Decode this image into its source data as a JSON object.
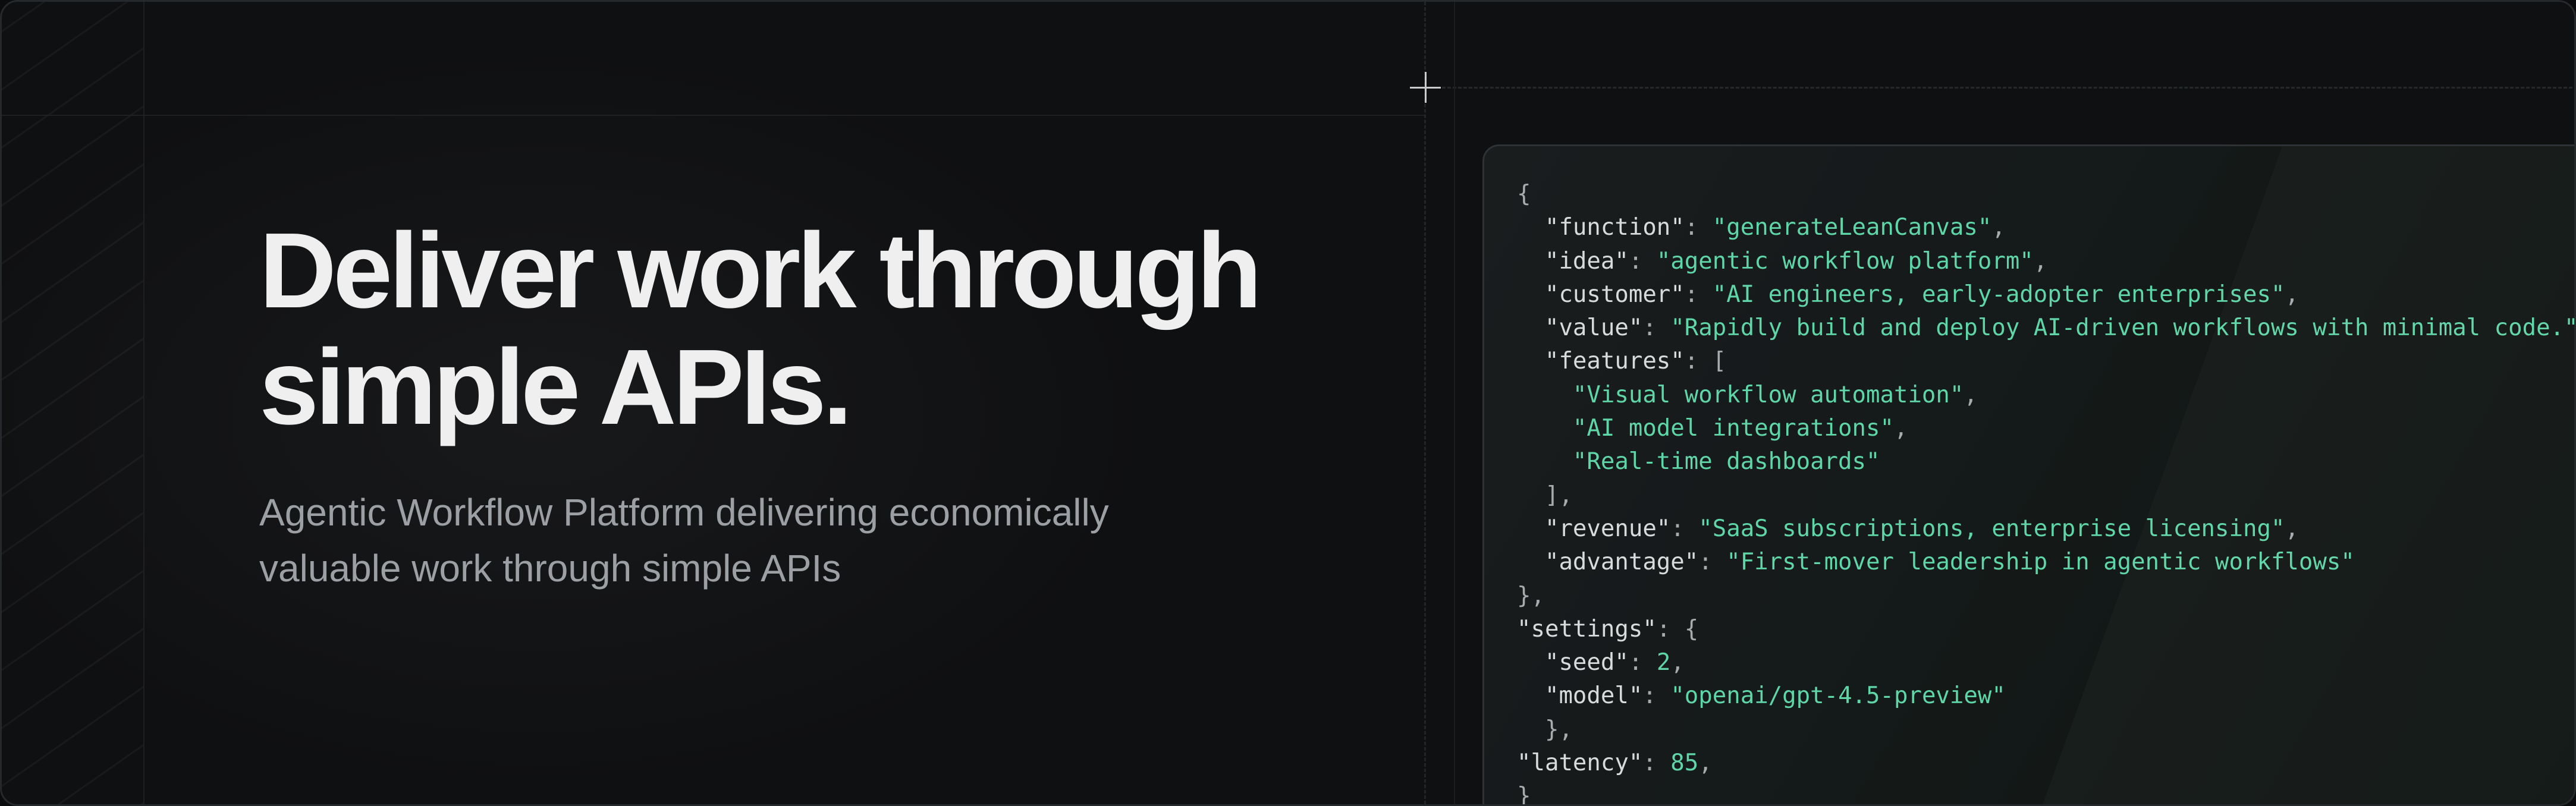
{
  "headline": {
    "line1": "Deliver work through",
    "line2": "simple APIs."
  },
  "subheadline": {
    "line1": "Agentic Workflow Platform delivering economically",
    "line2": "valuable work through simple APIs"
  },
  "code_sample": {
    "lines": [
      [
        {
          "t": "p",
          "v": "{"
        }
      ],
      [
        {
          "t": "p",
          "v": "  "
        },
        {
          "t": "k",
          "v": "\"function\""
        },
        {
          "t": "p",
          "v": ": "
        },
        {
          "t": "s",
          "v": "\"generateLeanCanvas\""
        },
        {
          "t": "p",
          "v": ","
        }
      ],
      [
        {
          "t": "p",
          "v": "  "
        },
        {
          "t": "k",
          "v": "\"idea\""
        },
        {
          "t": "p",
          "v": ": "
        },
        {
          "t": "s",
          "v": "\"agentic workflow platform\""
        },
        {
          "t": "p",
          "v": ","
        }
      ],
      [
        {
          "t": "p",
          "v": "  "
        },
        {
          "t": "k",
          "v": "\"customer\""
        },
        {
          "t": "p",
          "v": ": "
        },
        {
          "t": "s",
          "v": "\"AI engineers, early-adopter enterprises\""
        },
        {
          "t": "p",
          "v": ","
        }
      ],
      [
        {
          "t": "p",
          "v": "  "
        },
        {
          "t": "k",
          "v": "\"value\""
        },
        {
          "t": "p",
          "v": ": "
        },
        {
          "t": "s",
          "v": "\"Rapidly build and deploy AI-driven workflows with minimal code.\""
        }
      ],
      [
        {
          "t": "p",
          "v": "  "
        },
        {
          "t": "k",
          "v": "\"features\""
        },
        {
          "t": "p",
          "v": ": ["
        }
      ],
      [
        {
          "t": "p",
          "v": "    "
        },
        {
          "t": "s",
          "v": "\"Visual workflow automation\""
        },
        {
          "t": "p",
          "v": ","
        }
      ],
      [
        {
          "t": "p",
          "v": "    "
        },
        {
          "t": "s",
          "v": "\"AI model integrations\""
        },
        {
          "t": "p",
          "v": ","
        }
      ],
      [
        {
          "t": "p",
          "v": "    "
        },
        {
          "t": "s",
          "v": "\"Real-time dashboards\""
        }
      ],
      [
        {
          "t": "p",
          "v": "  ],"
        }
      ],
      [
        {
          "t": "p",
          "v": "  "
        },
        {
          "t": "k",
          "v": "\"revenue\""
        },
        {
          "t": "p",
          "v": ": "
        },
        {
          "t": "s",
          "v": "\"SaaS subscriptions, enterprise licensing\""
        },
        {
          "t": "p",
          "v": ","
        }
      ],
      [
        {
          "t": "p",
          "v": "  "
        },
        {
          "t": "k",
          "v": "\"advantage\""
        },
        {
          "t": "p",
          "v": ": "
        },
        {
          "t": "s",
          "v": "\"First-mover leadership in agentic workflows\""
        }
      ],
      [
        {
          "t": "p",
          "v": "},"
        }
      ],
      [
        {
          "t": "k",
          "v": "\"settings\""
        },
        {
          "t": "p",
          "v": ": {"
        }
      ],
      [
        {
          "t": "p",
          "v": "  "
        },
        {
          "t": "k",
          "v": "\"seed\""
        },
        {
          "t": "p",
          "v": ": "
        },
        {
          "t": "n",
          "v": "2"
        },
        {
          "t": "p",
          "v": ","
        }
      ],
      [
        {
          "t": "p",
          "v": "  "
        },
        {
          "t": "k",
          "v": "\"model\""
        },
        {
          "t": "p",
          "v": ": "
        },
        {
          "t": "s",
          "v": "\"openai/gpt-4.5-preview\""
        }
      ],
      [
        {
          "t": "p",
          "v": "  },"
        }
      ],
      [
        {
          "t": "k",
          "v": "\"latency\""
        },
        {
          "t": "p",
          "v": ": "
        },
        {
          "t": "n",
          "v": "85"
        },
        {
          "t": "p",
          "v": ","
        }
      ],
      [
        {
          "t": "p",
          "v": "}"
        }
      ]
    ]
  },
  "colors": {
    "background": "#0f1011",
    "headline": "#efefef",
    "subheadline": "#9c9fa3",
    "code_key": "#d8dadb",
    "code_string": "#5fd6a8"
  }
}
